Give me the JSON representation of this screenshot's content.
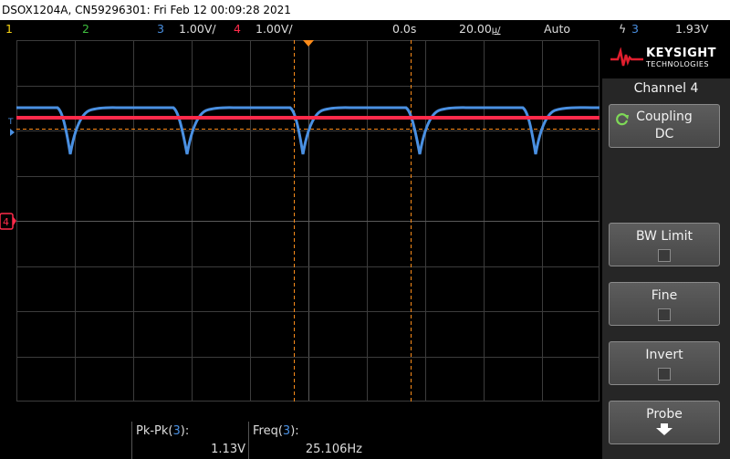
{
  "title_bar": {
    "text": "DSOX1204A, CN59296301: Fri Feb 12 00:09:28 2021"
  },
  "status": {
    "ch1": "1",
    "ch2": "2",
    "ch3_num": "3",
    "ch3_scale": "1.00V/",
    "ch4_num": "4",
    "ch4_scale": "1.00V/",
    "time_offset": "0.0s",
    "time_scale": "20.00",
    "time_scale_unit": "µ/",
    "trigger_mode": "Auto",
    "trigger_slope": "ϟ",
    "trigger_source": "3",
    "trigger_level": "1.93V"
  },
  "screen": {
    "trigger_marker": "T",
    "channel4_marker": "4"
  },
  "measurements": [
    {
      "label": "Pk-Pk(",
      "channel": "3",
      "suffix": "):",
      "value": "1.13V"
    },
    {
      "label": "Freq(",
      "channel": "3",
      "suffix": "):",
      "value": "25.106Hz"
    }
  ],
  "sidebar": {
    "brand": "KEYSIGHT",
    "brand_sub": "TECHNOLOGIES",
    "menu_title": "Channel 4",
    "softkeys": [
      {
        "label": "Coupling",
        "value": "DC"
      },
      {
        "label": "BW Limit"
      },
      {
        "label": "Fine"
      },
      {
        "label": "Invert"
      },
      {
        "label": "Probe"
      }
    ]
  },
  "colors": {
    "ch1": "#f5d214",
    "ch2": "#3fbf3f",
    "ch3": "#4a90e2",
    "ch4": "#ff2a4a",
    "trigger": "#ff8c1a",
    "grid": "#3c3c3c",
    "brand": "#e01e2e",
    "coupling_icon": "#7ed957"
  }
}
